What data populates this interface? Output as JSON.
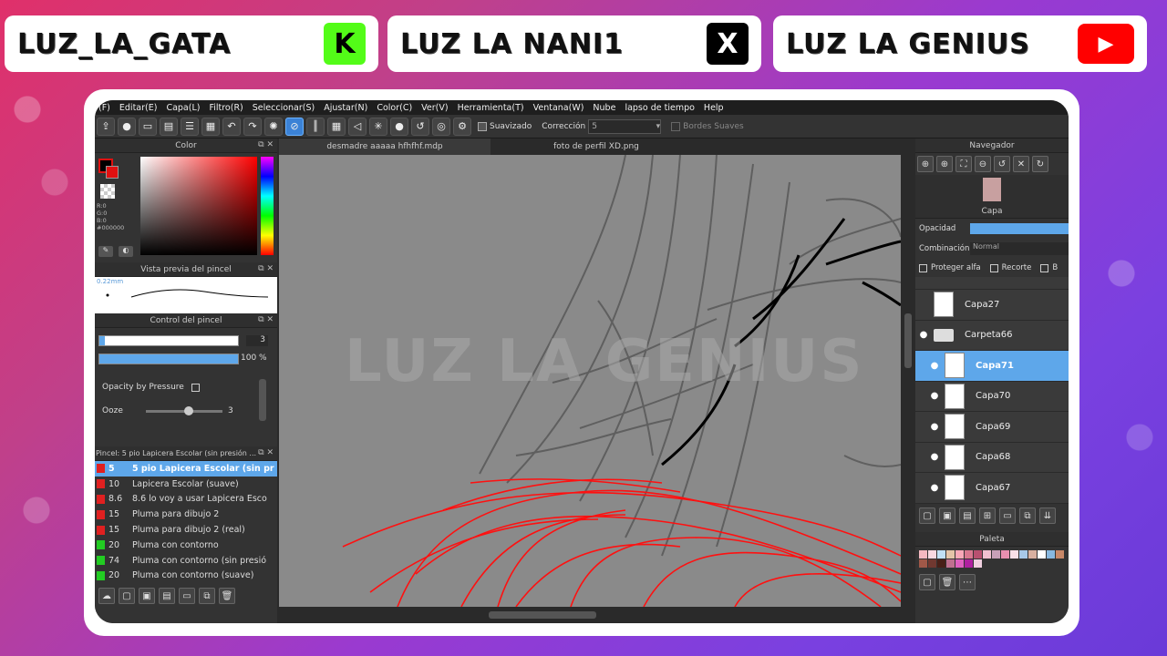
{
  "badges": [
    {
      "text": "LUZ_LA_GATA",
      "icon": "kick-icon",
      "icon_glyph": "K",
      "bg": "#53fc18",
      "fg": "#000"
    },
    {
      "text": "LUZ LA NANI1",
      "icon": "x-icon",
      "icon_glyph": "X",
      "bg": "#000",
      "fg": "#fff"
    },
    {
      "text": "LUZ LA GENIUS",
      "icon": "youtube-icon",
      "icon_glyph": "▶",
      "bg": "#ff0000",
      "fg": "#fff"
    }
  ],
  "menu": [
    "(F)",
    "Editar(E)",
    "Capa(L)",
    "Filtro(R)",
    "Seleccionar(S)",
    "Ajustar(N)",
    "Color(C)",
    "Ver(V)",
    "Herramienta(T)",
    "Ventana(W)",
    "Nube",
    "lapso de tiempo",
    "Help"
  ],
  "toolbar": {
    "smooth_label": "Suavizado",
    "correction_label": "Corrección",
    "correction_value": "5",
    "soft_edges_label": "Bordes Suaves"
  },
  "tabs": [
    "desmadre aaaaa hfhfhf.mdp",
    "foto de perfil XD.png"
  ],
  "color_panel": {
    "title": "Color",
    "values": [
      "R:0",
      "G:0",
      "B:0",
      "#000000"
    ]
  },
  "brush_preview": {
    "title": "Vista previa del pincel",
    "size_label": "0.22mm"
  },
  "brush_control": {
    "title": "Control del pincel",
    "size_value": "3",
    "opacity_value": "100 %",
    "opacity_pressure_label": "Opacity by Pressure",
    "ooze_label": "Ooze",
    "ooze_value": "3"
  },
  "brush_list": {
    "title": "Pincel: 5 pio Lapicera Escolar (sin presión ...",
    "items": [
      {
        "num": "5",
        "name": "5 pio Lapicera Escolar (sin pr",
        "color": "#e02020",
        "selected": true
      },
      {
        "num": "10",
        "name": "Lapicera Escolar (suave)",
        "color": "#e02020"
      },
      {
        "num": "8.6",
        "name": "8.6 lo voy a usar Lapicera Esco",
        "color": "#e02020"
      },
      {
        "num": "15",
        "name": "Pluma para dibujo 2",
        "color": "#e02020"
      },
      {
        "num": "15",
        "name": "Pluma para dibujo 2 (real)",
        "color": "#e02020"
      },
      {
        "num": "20",
        "name": "Pluma con contorno",
        "color": "#22cc22"
      },
      {
        "num": "74",
        "name": "Pluma con contorno (sin presió",
        "color": "#22cc22"
      },
      {
        "num": "20",
        "name": "Pluma con contorno (suave)",
        "color": "#22cc22"
      }
    ]
  },
  "canvas": {
    "watermark": "LUZ LA GENIUS"
  },
  "navigator": {
    "title": "Navegador"
  },
  "layers_panel": {
    "title": "Capa",
    "opacity_label": "Opacidad",
    "blend_label": "Combinación",
    "blend_value": "Normal",
    "protect_alpha_label": "Proteger alfa",
    "clip_label": "Recorte",
    "extra_label": "B",
    "layers": [
      {
        "name": "Capa27",
        "type": "layer",
        "visible": false,
        "selected": false,
        "indent": 0
      },
      {
        "name": "Carpeta66",
        "type": "folder",
        "visible": true,
        "selected": false,
        "indent": 0
      },
      {
        "name": "Capa71",
        "type": "layer",
        "visible": true,
        "selected": true,
        "indent": 1
      },
      {
        "name": "Capa70",
        "type": "layer",
        "visible": true,
        "selected": false,
        "indent": 1
      },
      {
        "name": "Capa69",
        "type": "layer",
        "visible": true,
        "selected": false,
        "indent": 1
      },
      {
        "name": "Capa68",
        "type": "layer",
        "visible": true,
        "selected": false,
        "indent": 1
      },
      {
        "name": "Capa67",
        "type": "layer",
        "visible": true,
        "selected": false,
        "indent": 1
      }
    ]
  },
  "palette": {
    "title": "Paleta",
    "colors": [
      "#f4b8c0",
      "#f8d8e0",
      "#c0e0f4",
      "#e4c4a8",
      "#f8a8b8",
      "#d87890",
      "#b85070",
      "#f0c0d0",
      "#c8a0b8",
      "#e890b0",
      "#f8e0e8",
      "#a8c8e8",
      "#d8b0a0",
      "#ffffff",
      "#88b8e0",
      "#c88868",
      "#a05848",
      "#703830",
      "#482018",
      "#c07090",
      "#e060c0",
      "#b020a0",
      "#f0d0e0"
    ]
  }
}
